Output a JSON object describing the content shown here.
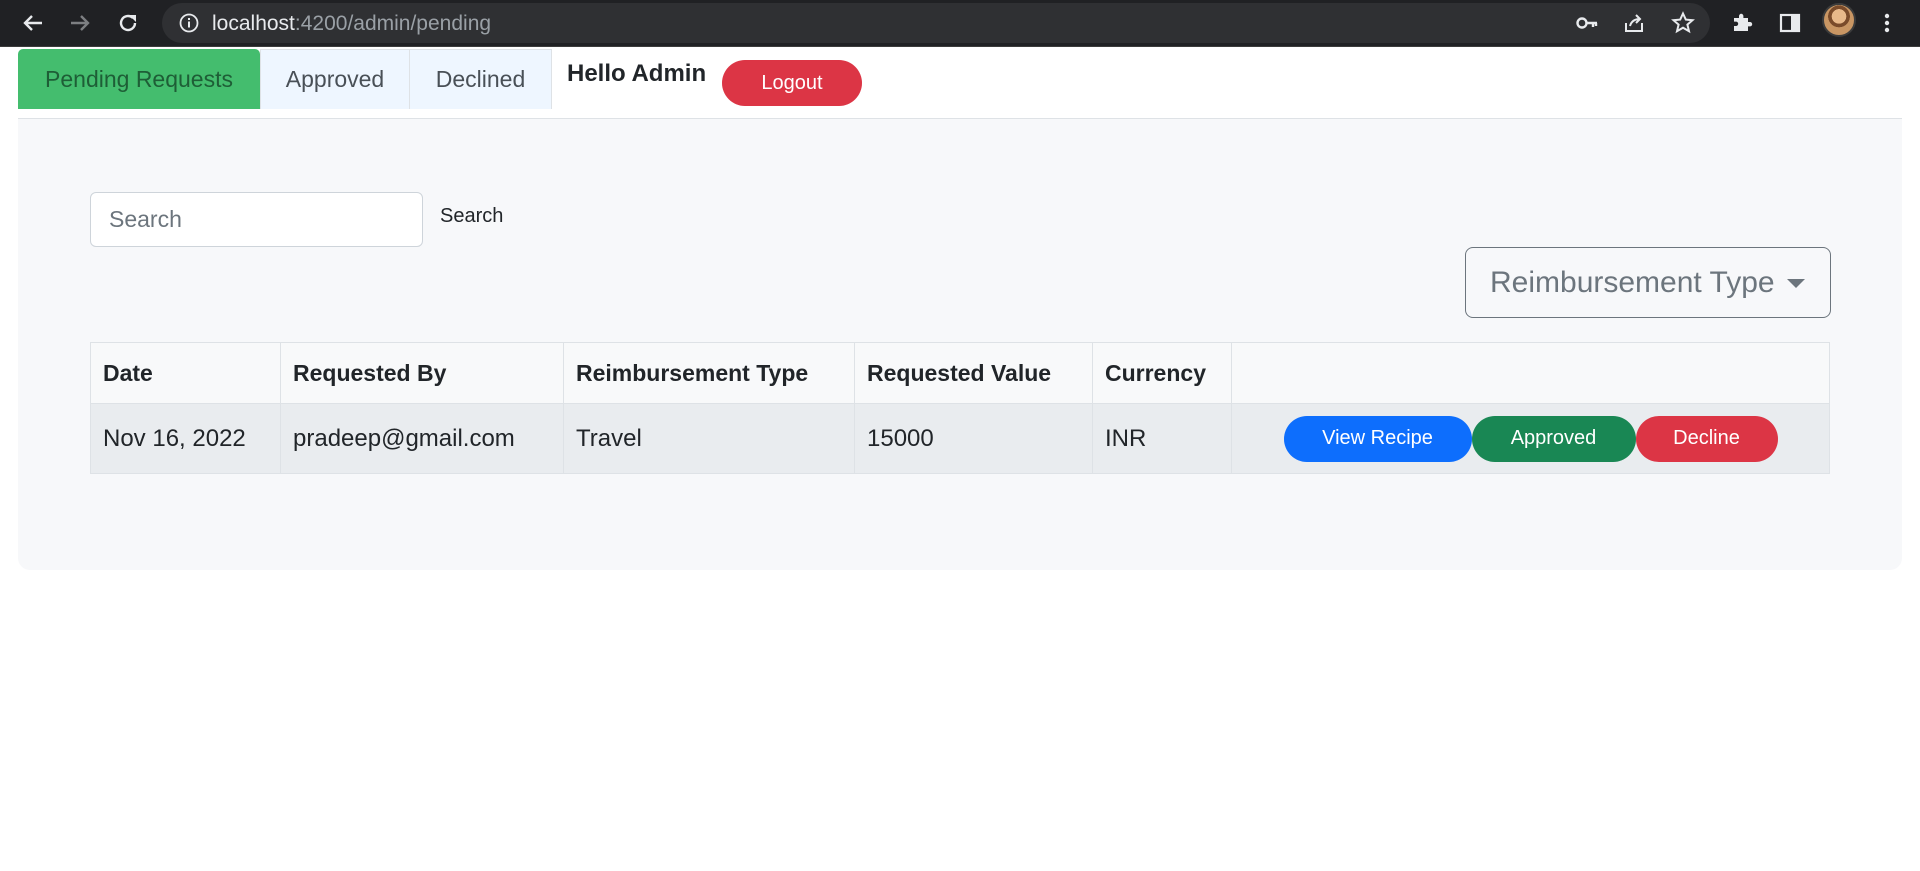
{
  "browser": {
    "url_host": "localhost",
    "url_rest": ":4200/admin/pending"
  },
  "header": {
    "tabs": [
      {
        "label": "Pending Requests",
        "active": true
      },
      {
        "label": "Approved",
        "active": false
      },
      {
        "label": "Declined",
        "active": false
      }
    ],
    "greeting": "Hello Admin",
    "logout_label": "Logout"
  },
  "search": {
    "placeholder": "Search",
    "value": "",
    "button_label": "Search"
  },
  "filter": {
    "label": "Reimbursement Type"
  },
  "table": {
    "headers": [
      "Date",
      "Requested By",
      "Reimbursement Type",
      "Requested Value",
      "Currency",
      ""
    ],
    "rows": [
      {
        "date": "Nov 16, 2022",
        "requested_by": "pradeep@gmail.com",
        "type": "Travel",
        "value": "15000",
        "currency": "INR",
        "actions": {
          "view": "View Recipe",
          "approve": "Approved",
          "decline": "Decline"
        }
      }
    ]
  },
  "colors": {
    "active_tab": "#44bd6e",
    "primary": "#0d6efd",
    "success": "#198754",
    "danger": "#dc3545"
  }
}
